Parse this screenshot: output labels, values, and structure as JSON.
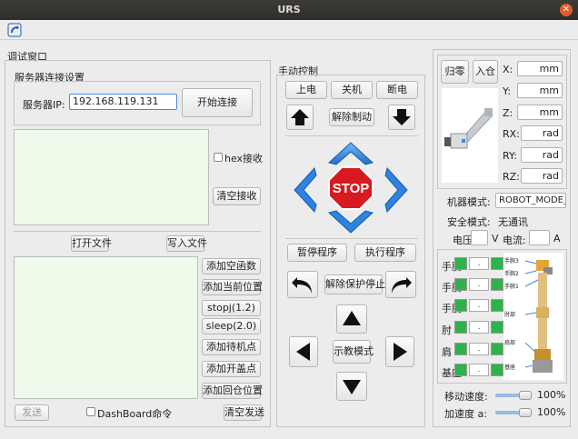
{
  "window": {
    "title": "URS"
  },
  "debug": {
    "title": "调试窗口",
    "server_group": "服务器连接设置",
    "server_label": "服务器IP:",
    "server_ip": "192.168.119.131",
    "connect": "开始连接",
    "hex_receive": "hex接收",
    "clear_receive": "清空接收",
    "open_file": "打开文件",
    "write_file": "写入文件",
    "cmds": [
      "添加空函数",
      "添加当前位置",
      "stopj(1.2)",
      "sleep(2.0)",
      "添加待机点",
      "添加开盖点",
      "添加回仓位置"
    ],
    "send": "发送",
    "dashboard": "DashBoard命令",
    "clear_send": "清空发送"
  },
  "manual": {
    "title": "手动控制",
    "power_on": "上电",
    "power_off": "关机",
    "power_cut": "断电",
    "release_brake": "解除制动",
    "stop": "STOP",
    "pause_program": "暂停程序",
    "run_program": "执行程序",
    "release_protective_stop": "解除保护停止",
    "teach_mode": "示教模式"
  },
  "robot": {
    "home": "归零",
    "store": "入仓",
    "coords": [
      {
        "label": "X:",
        "unit": "mm"
      },
      {
        "label": "Y:",
        "unit": "mm"
      },
      {
        "label": "Z:",
        "unit": "mm"
      },
      {
        "label": "RX:",
        "unit": "rad"
      },
      {
        "label": "RY:",
        "unit": "rad"
      },
      {
        "label": "RZ:",
        "unit": "rad"
      }
    ],
    "machine_mode_label": "机器模式:",
    "machine_mode": "ROBOT_MODE_I",
    "safety_mode_label": "安全模式:",
    "safety_mode": "无通讯",
    "voltage_label": "电压",
    "voltage_unit": "V",
    "current_label": "电流:",
    "current_unit": "A",
    "joint_labels": [
      "手腕",
      "手腕",
      "手腕",
      "肘",
      "肩",
      "基座"
    ],
    "joint_value_placeholder": ".",
    "diagram_labels": [
      "手腕3",
      "手腕2",
      "手腕1",
      "肘部",
      "肩部",
      "基座"
    ],
    "move_speed_label": "移动速度:",
    "move_speed": "100%",
    "move_speed_fraction": 1.0,
    "accel_label": "加速度 a:",
    "accel": "100%",
    "accel_fraction": 1.0
  }
}
